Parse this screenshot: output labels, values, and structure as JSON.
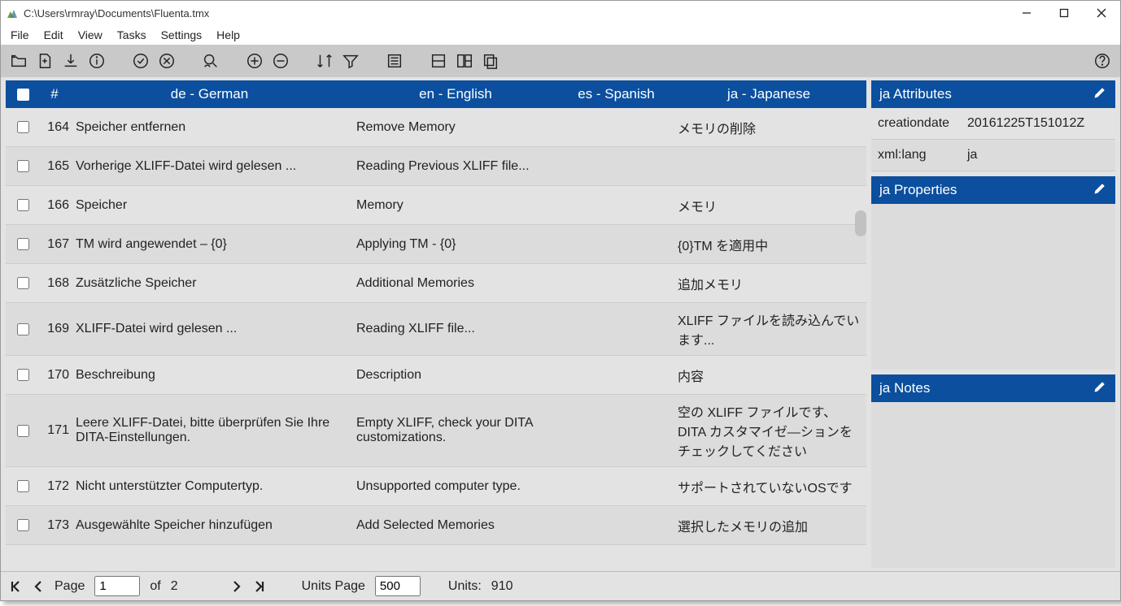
{
  "window": {
    "title": "C:\\Users\\rmray\\Documents\\Fluenta.tmx"
  },
  "menu": {
    "file": "File",
    "edit": "Edit",
    "view": "View",
    "tasks": "Tasks",
    "settings": "Settings",
    "help": "Help"
  },
  "headers": {
    "num": "#",
    "de": "de - German",
    "en": "en - English",
    "es": "es - Spanish",
    "ja": "ja - Japanese"
  },
  "rows": [
    {
      "n": "164",
      "de": "Speicher entfernen",
      "en": "Remove Memory",
      "es": "",
      "ja": "メモリの削除"
    },
    {
      "n": "165",
      "de": "Vorherige XLIFF-Datei wird gelesen ...",
      "en": "Reading Previous XLIFF file...",
      "es": "",
      "ja": ""
    },
    {
      "n": "166",
      "de": "Speicher",
      "en": "Memory",
      "es": "",
      "ja": "メモリ"
    },
    {
      "n": "167",
      "de": "TM wird angewendet – {0}",
      "en": "Applying TM - {0}",
      "es": "",
      "ja": "{0}TM を適用中"
    },
    {
      "n": "168",
      "de": "Zusätzliche Speicher",
      "en": "Additional Memories",
      "es": "",
      "ja": "追加メモリ"
    },
    {
      "n": "169",
      "de": "XLIFF-Datei wird gelesen ...",
      "en": "Reading XLIFF file...",
      "es": "",
      "ja": "XLIFF ファイルを読み込んでいます..."
    },
    {
      "n": "170",
      "de": "Beschreibung",
      "en": "Description",
      "es": "",
      "ja": "内容"
    },
    {
      "n": "171",
      "de": "Leere XLIFF-Datei, bitte überprüfen Sie Ihre DITA-Einstellungen.",
      "en": "Empty XLIFF, check your DITA customizations.",
      "es": "",
      "ja": "空の XLIFF ファイルです、DITA カスタマイゼ―ションをチェックしてください"
    },
    {
      "n": "172",
      "de": "Nicht unterstützter Computertyp.",
      "en": "Unsupported computer type.",
      "es": "",
      "ja": "サポートされていないOSです"
    },
    {
      "n": "173",
      "de": "Ausgewählte Speicher hinzufügen",
      "en": "Add Selected Memories",
      "es": "",
      "ja": "選択したメモリの追加"
    }
  ],
  "panels": {
    "attributes": {
      "title": "ja  Attributes",
      "rows": [
        {
          "k": "creationdate",
          "v": "20161225T151012Z"
        },
        {
          "k": "xml:lang",
          "v": "ja"
        }
      ]
    },
    "properties": {
      "title": "ja  Properties"
    },
    "notes": {
      "title": "ja  Notes"
    }
  },
  "status": {
    "page_label": "Page",
    "page_value": "1",
    "of": "of",
    "total_pages": "2",
    "units_page_label": "Units Page",
    "units_page_value": "500",
    "units_label": "Units:",
    "units_total": "910"
  }
}
